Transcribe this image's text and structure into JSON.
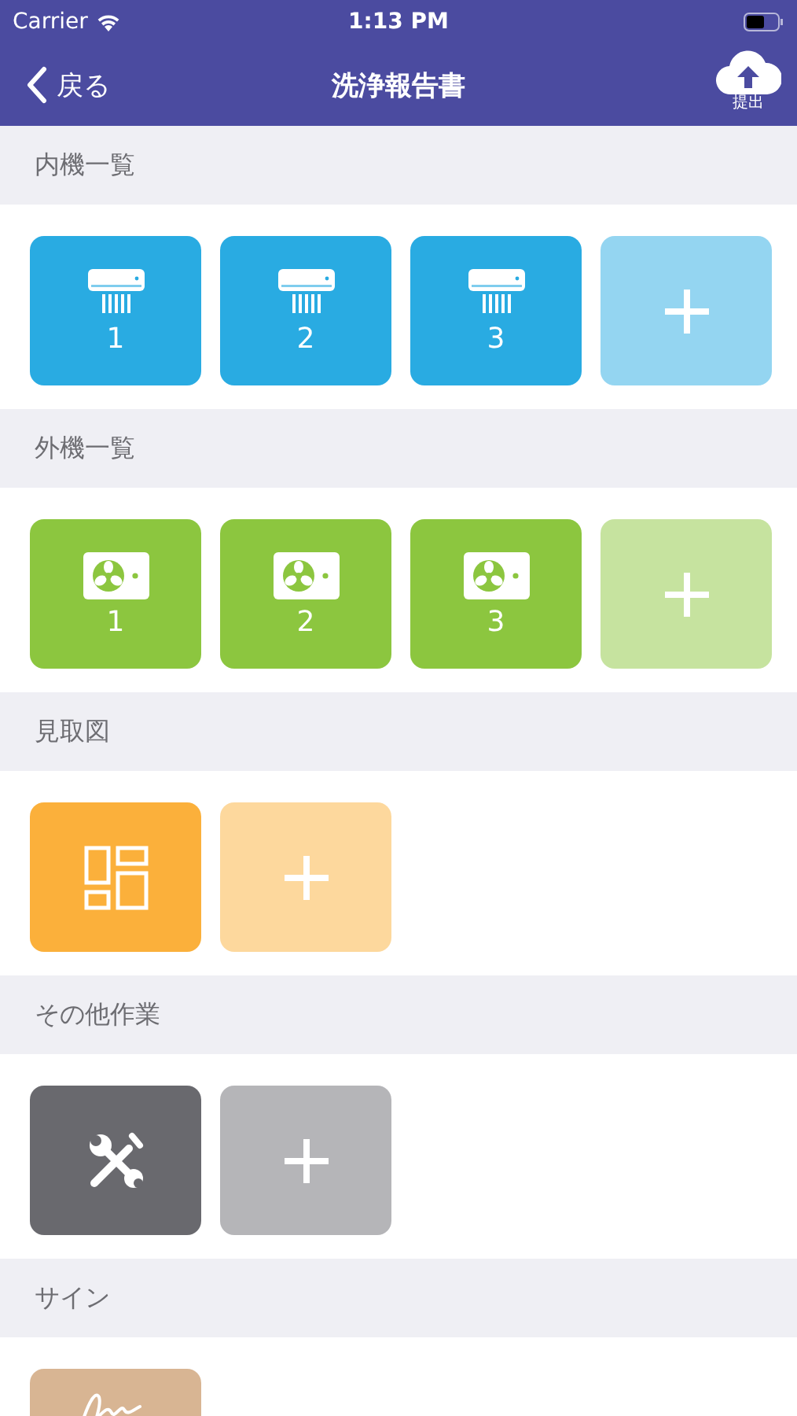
{
  "status_bar": {
    "carrier": "Carrier",
    "time": "1:13 PM"
  },
  "nav": {
    "back": "戻る",
    "title": "洗浄報告書",
    "submit": "提出"
  },
  "sections": [
    {
      "title": "内機一覧",
      "kind": "indoor",
      "color": "#29abe2",
      "tiles": [
        {
          "kind": "unit",
          "label": "1"
        },
        {
          "kind": "unit",
          "label": "2"
        },
        {
          "kind": "unit",
          "label": "3"
        },
        {
          "kind": "add"
        }
      ]
    },
    {
      "title": "外機一覧",
      "kind": "outdoor",
      "color": "#8cc63f",
      "tiles": [
        {
          "kind": "unit",
          "label": "1"
        },
        {
          "kind": "unit",
          "label": "2"
        },
        {
          "kind": "unit",
          "label": "3"
        },
        {
          "kind": "add"
        }
      ]
    },
    {
      "title": "見取図",
      "kind": "floorplan",
      "color": "#fbb03b",
      "tiles": [
        {
          "kind": "unit"
        },
        {
          "kind": "add"
        }
      ]
    },
    {
      "title": "その他作業",
      "kind": "other",
      "color": "#69696e",
      "tiles": [
        {
          "kind": "unit"
        },
        {
          "kind": "add"
        }
      ]
    },
    {
      "title": "サイン",
      "kind": "sign",
      "color": "#d8b593",
      "tiles": [
        {
          "kind": "unit"
        }
      ]
    }
  ]
}
